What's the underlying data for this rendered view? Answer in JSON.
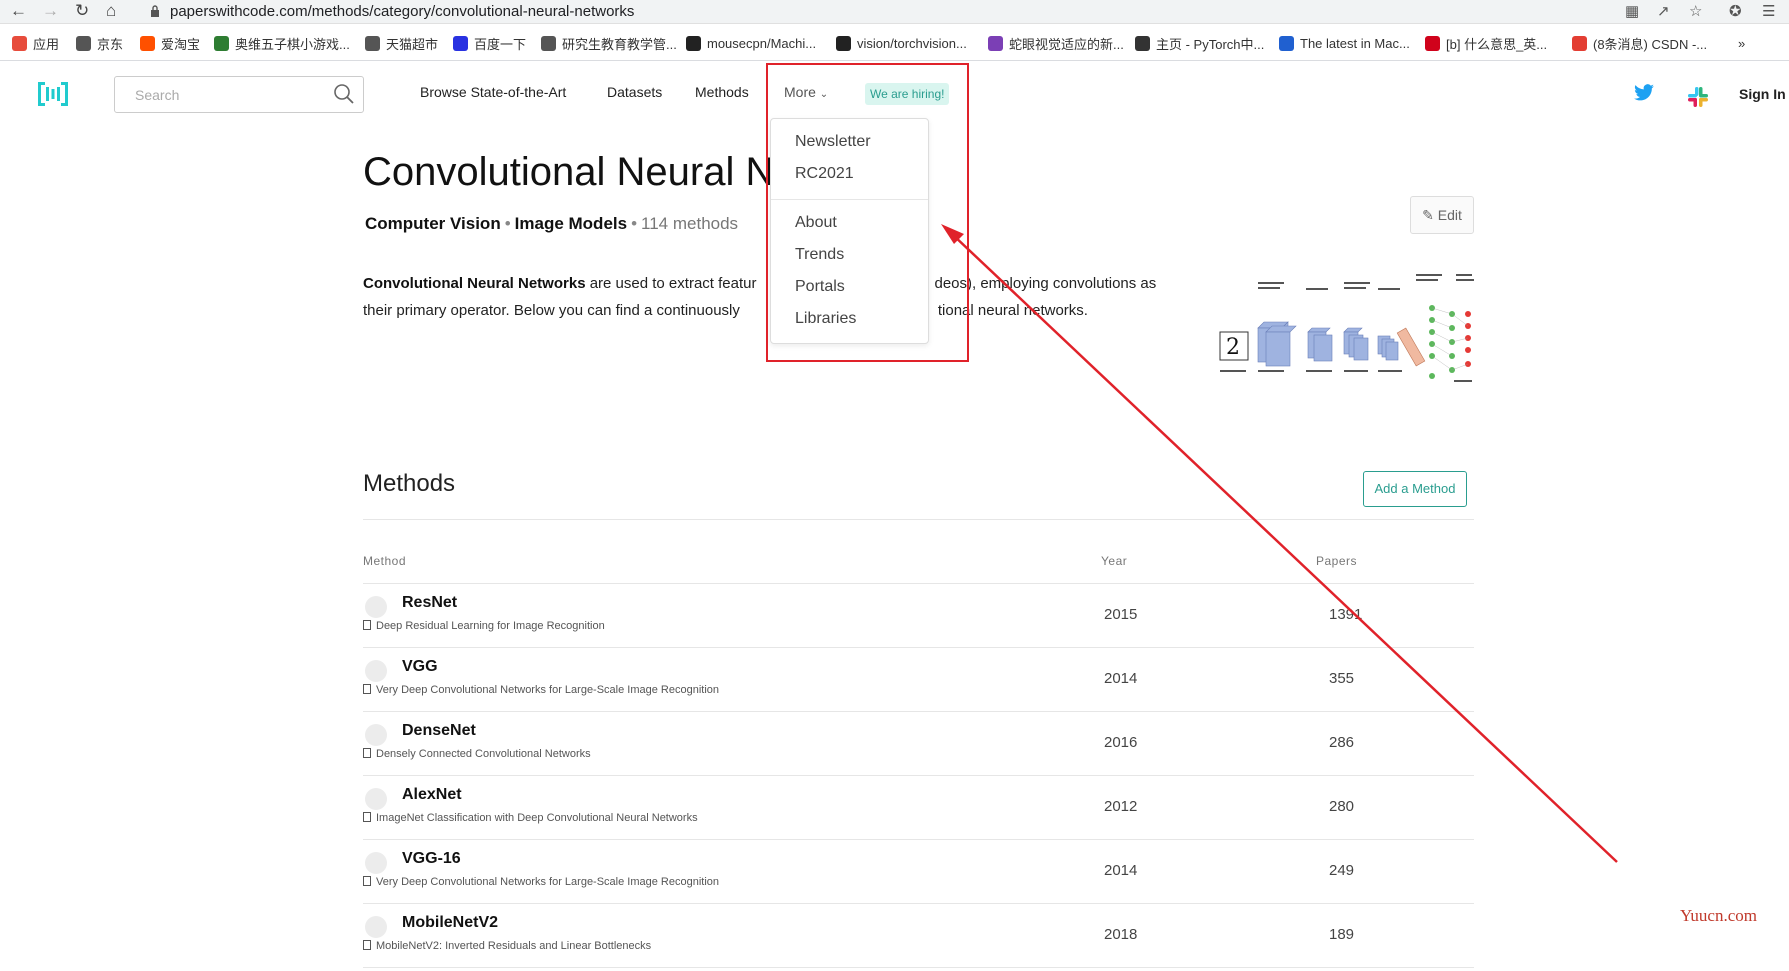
{
  "browser": {
    "url": "paperswithcode.com/methods/category/convolutional-neural-networks",
    "bookmarks": [
      {
        "label": "应用",
        "color": "#e74c3c"
      },
      {
        "label": "京东",
        "color": "#555555"
      },
      {
        "label": "爱淘宝",
        "color": "#ff5000"
      },
      {
        "label": "奥维五子棋小游戏...",
        "color": "#2e7d32"
      },
      {
        "label": "天猫超市",
        "color": "#555555"
      },
      {
        "label": "百度一下",
        "color": "#2932e1"
      },
      {
        "label": "研究生教育教学管...",
        "color": "#555555"
      },
      {
        "label": "mousecpn/Machi...",
        "color": "#222222"
      },
      {
        "label": "vision/torchvision...",
        "color": "#222222"
      },
      {
        "label": "蛇眼视觉适应的新...",
        "color": "#7b3fb5"
      },
      {
        "label": "主页 - PyTorch中...",
        "color": "#333333"
      },
      {
        "label": "The latest in Mac...",
        "color": "#2060d0"
      },
      {
        "label": "[b] 什么意思_英...",
        "color": "#d0021b"
      },
      {
        "label": "(8条消息) CSDN -...",
        "color": "#e33e33"
      }
    ]
  },
  "header": {
    "search_placeholder": "Search",
    "nav": [
      "Browse State-of-the-Art",
      "Datasets",
      "Methods",
      "More"
    ],
    "hiring": "We are hiring!",
    "signin": "Sign In"
  },
  "dropdown": {
    "group1": [
      "Newsletter",
      "RC2021"
    ],
    "group2": [
      "About",
      "Trends",
      "Portals",
      "Libraries"
    ]
  },
  "page": {
    "title": "Convolutional Neural N",
    "crumb1": "Computer Vision",
    "crumb2": "Image Models",
    "count": "114 methods",
    "edit": "Edit",
    "desc_bold": "Convolutional Neural Networks",
    "desc_line1_a": " are used to extract featur",
    "desc_line1_b": "deos), employing convolutions as",
    "desc_line2_a": "their primary operator. Below you can find a continuously",
    "desc_line2_b": "tional neural networks."
  },
  "methods": {
    "heading": "Methods",
    "add_button": "Add a Method",
    "columns": [
      "Method",
      "Year",
      "Papers"
    ],
    "rows": [
      {
        "name": "ResNet",
        "paper": "Deep Residual Learning for Image Recognition",
        "year": "2015",
        "papers": "1391"
      },
      {
        "name": "VGG",
        "paper": "Very Deep Convolutional Networks for Large-Scale Image Recognition",
        "year": "2014",
        "papers": "355"
      },
      {
        "name": "DenseNet",
        "paper": "Densely Connected Convolutional Networks",
        "year": "2016",
        "papers": "286"
      },
      {
        "name": "AlexNet",
        "paper": "ImageNet Classification with Deep Convolutional Neural Networks",
        "year": "2012",
        "papers": "280"
      },
      {
        "name": "VGG-16",
        "paper": "Very Deep Convolutional Networks for Large-Scale Image Recognition",
        "year": "2014",
        "papers": "249"
      },
      {
        "name": "MobileNetV2",
        "paper": "MobileNetV2: Inverted Residuals and Linear Bottlenecks",
        "year": "2018",
        "papers": "189"
      }
    ]
  },
  "watermark": "Yuucn.com",
  "colors": {
    "accent": "#2a9d8f",
    "annotation": "#e0222a"
  }
}
